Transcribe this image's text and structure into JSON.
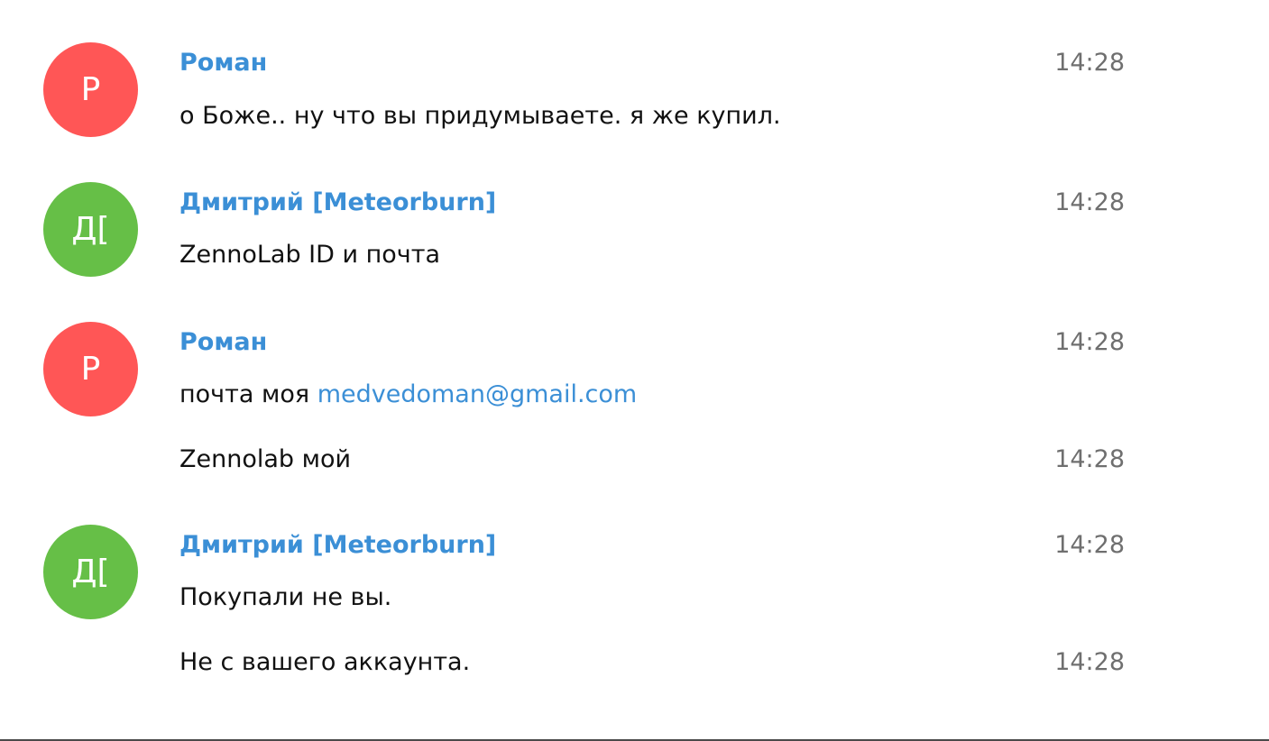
{
  "colors": {
    "author_link": "#3b8fd6",
    "avatar_red": "#ff5656",
    "avatar_green": "#66bf47",
    "time": "#6f6f6f",
    "text": "#111111"
  },
  "messages": [
    {
      "avatar_initials": "Р",
      "author": "Роман",
      "time": "14:28",
      "lines": [
        {
          "text": "о Боже.. ну что вы придумываете. я же купил."
        }
      ]
    },
    {
      "avatar_initials": "Д[",
      "author": "Дмитрий [Meteorburn]",
      "time": "14:28",
      "lines": [
        {
          "text": "ZennoLab ID и почта"
        }
      ]
    },
    {
      "avatar_initials": "Р",
      "author": "Роман",
      "time": "14:28",
      "lines": [
        {
          "text": "почта моя ",
          "link": "medvedoman@gmail.com"
        },
        {
          "text": "Zennolab мой",
          "time": "14:28"
        }
      ]
    },
    {
      "avatar_initials": "Д[",
      "author": "Дмитрий [Meteorburn]",
      "time": "14:28",
      "lines": [
        {
          "text": "Покупали не вы."
        },
        {
          "text": "Не с вашего аккаунта.",
          "time": "14:28"
        }
      ]
    }
  ]
}
